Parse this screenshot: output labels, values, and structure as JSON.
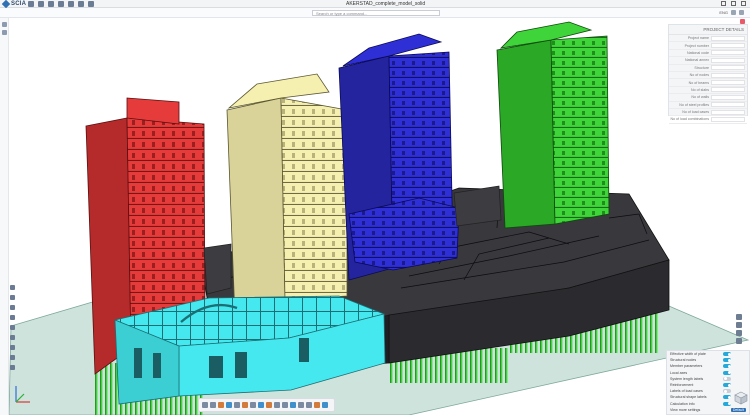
{
  "app": {
    "brand": "SCIA",
    "document_title": "AKERSTAD_complete_model_solid"
  },
  "search": {
    "placeholder": "Search or type a command..."
  },
  "user": {
    "label": "ENG"
  },
  "properties": {
    "title": "PROJECT DETAILS",
    "fields": [
      {
        "label": "Project name"
      },
      {
        "label": "Project number"
      },
      {
        "label": "National code"
      },
      {
        "label": "National annex"
      },
      {
        "label": "Structure"
      },
      {
        "label": "No of nodes"
      },
      {
        "label": "No of beams"
      },
      {
        "label": "No of slabs"
      },
      {
        "label": "No of walls"
      },
      {
        "label": "No of steel profiles"
      },
      {
        "label": "No of load cases"
      },
      {
        "label": "No of load combinations"
      }
    ]
  },
  "display": {
    "rows": [
      {
        "label": "Effective width of plate",
        "on": true
      },
      {
        "label": "Structural nodes",
        "on": true
      },
      {
        "label": "Member parameters",
        "on": true
      },
      {
        "label": "Local axes",
        "on": true
      },
      {
        "label": "System length labels",
        "on": false
      },
      {
        "label": "Reinforcement",
        "on": true
      },
      {
        "label": "Labels of load cases",
        "on": false
      },
      {
        "label": "Structural shape labels",
        "on": true
      },
      {
        "label": "Calculation info",
        "on": true
      }
    ],
    "footer_label": "View more settings",
    "footer_button": "Default"
  },
  "colors": {
    "red_tower": "#e63b3b",
    "yellow_tower": "#f5efb0",
    "blue_tower": "#2f2fd6",
    "green_tower": "#3fd43a",
    "cyan_block": "#45e8ee",
    "black_podium": "#2b2b2f",
    "ground": "#cfe3dd",
    "piles": "#3ed43b",
    "accent": "#2f6fb4"
  },
  "icons": {
    "brand": "scia-logo-icon",
    "view_cube": "view-cube-icon",
    "axes": "axis-triad-icon"
  }
}
